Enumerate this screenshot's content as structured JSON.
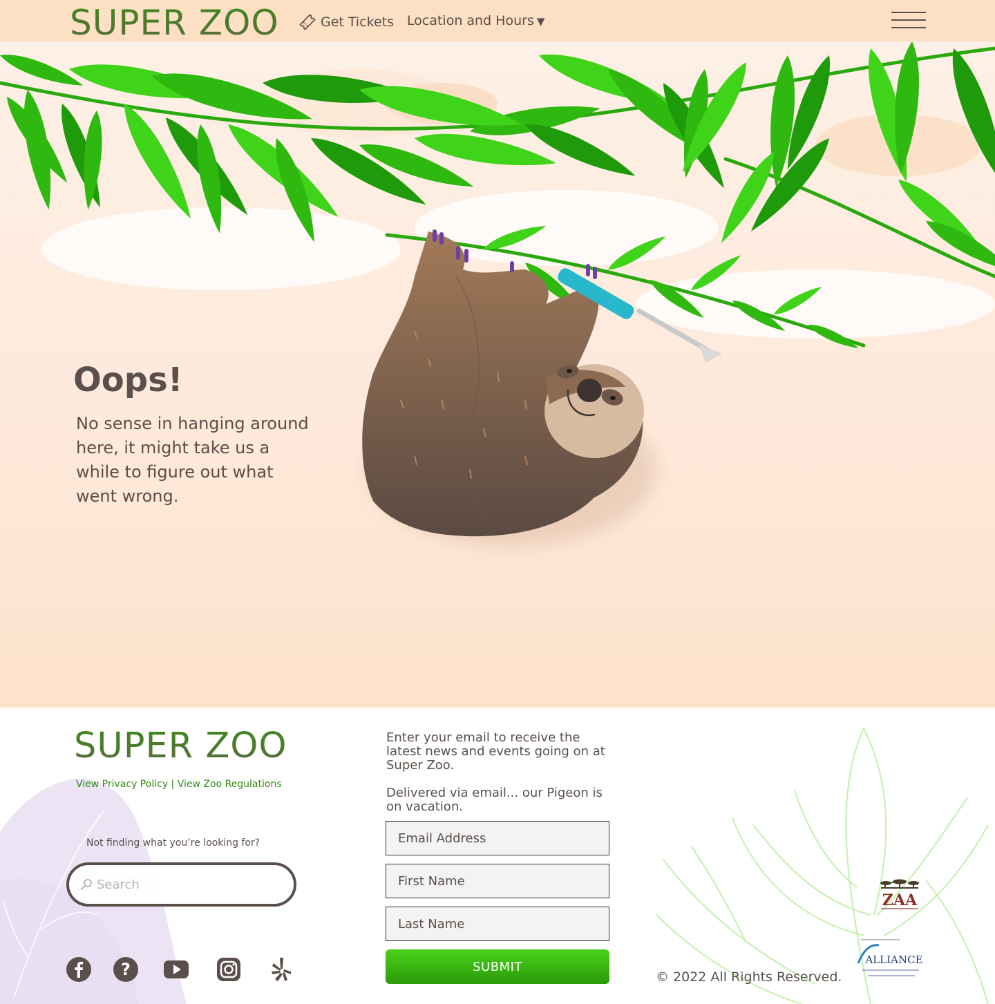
{
  "header": {
    "logo": "SUPER ZOO",
    "nav": {
      "tickets": "Get Tickets",
      "location": "Location and Hours",
      "location_caret": "▼"
    }
  },
  "hero": {
    "title": "Oops!",
    "message": "No sense in hanging around here, it might take us a while to figure out what went wrong."
  },
  "footer": {
    "logo": "SUPER ZOO",
    "privacy_link": "View Privacy Policy",
    "separator": " | ",
    "regulations_link": "View Zoo Regulations",
    "not_finding": "Not finding what you’re looking for?",
    "search_placeholder": "Search",
    "newsletter_intro": "Enter your email to receive the latest news and events going on at Super Zoo.",
    "newsletter_note": "Delivered via email... our Pigeon is on vacation.",
    "email_placeholder": "Email Address",
    "first_name_placeholder": "First Name",
    "last_name_placeholder": "Last Name",
    "submit_label": "SUBMIT",
    "copyright": "© 2022 All Rights Reserved.",
    "zaa_logo_text": "ZAA",
    "alliance_logo_text": "ALLIANCE",
    "social_icons": [
      "facebook-icon",
      "help-icon",
      "youtube-icon",
      "instagram-icon",
      "yelp-icon"
    ]
  },
  "colors": {
    "header_bg": "#fddfc3",
    "text": "#5a4f4a",
    "brand_green": "#3e8a1e",
    "link_green": "#2e8a10",
    "submit_green": "#38b812"
  }
}
